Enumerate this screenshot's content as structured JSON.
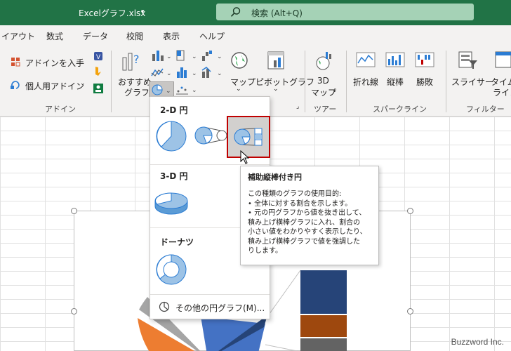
{
  "titlebar": {
    "filename": "Excelグラフ.xlsx",
    "caret": "▾",
    "search_placeholder": "検索 (Alt+Q)"
  },
  "tabs": [
    "イアウト",
    "数式",
    "データ",
    "校閲",
    "表示",
    "ヘルプ"
  ],
  "ribbon": {
    "addin_get": "アドインを入手",
    "addin_personal": "個人用アドイン",
    "addin_group": "アドイン",
    "recommended_charts_line1": "おすすめ",
    "recommended_charts_line2": "グラフ",
    "map": "マップ",
    "pivot_chart": "ピボットグラフ",
    "map3d_line1": "3D",
    "map3d_line2": "マップ",
    "tour_group": "ツアー",
    "spark_line": "折れ線",
    "spark_column": "縦棒",
    "spark_winloss": "勝敗",
    "sparkline_group": "スパークライン",
    "slicer": "スライサー",
    "timeline_line1": "タイム",
    "timeline_line2": "ライン",
    "filter_group": "フィルター"
  },
  "dropdown": {
    "section_2d": "2-D 円",
    "section_3d": "3-D 円",
    "section_donut": "ドーナツ",
    "more_charts": "その他の円グラフ(M)..."
  },
  "tooltip": {
    "title": "補助縦棒付き円",
    "lines": [
      "この種類のグラフの使用目的:",
      "• 全体に対する割合を示します。",
      "• 元の円グラフから値を抜き出して、",
      "積み上げ横棒グラフに入れ、割合の",
      "小さい値をわかりやすく表示したり、",
      "積み上げ横棒グラフで値を強調した",
      "りします。"
    ]
  },
  "watermark": "Buzzword Inc.",
  "colors": {
    "excel_green": "#217346",
    "accent_red": "#c00000",
    "pie_blue": "#9dc3e6"
  }
}
